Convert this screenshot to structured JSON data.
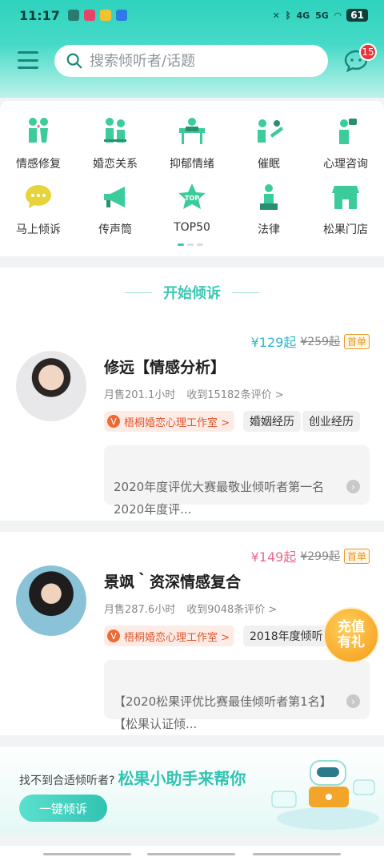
{
  "status": {
    "time": "11:17",
    "battery": "61",
    "net1": "4G",
    "net2": "5G"
  },
  "header": {
    "search_placeholder": "搜索倾听者/话题",
    "msg_badge": "15"
  },
  "categories": [
    {
      "label": "情感修复",
      "icon": "couple-icon"
    },
    {
      "label": "婚恋关系",
      "icon": "marriage-icon"
    },
    {
      "label": "抑郁情绪",
      "icon": "depression-icon"
    },
    {
      "label": "催眠",
      "icon": "hypnosis-icon"
    },
    {
      "label": "心理咨询",
      "icon": "counseling-icon"
    },
    {
      "label": "马上倾诉",
      "icon": "chat-bubble-icon"
    },
    {
      "label": "传声筒",
      "icon": "megaphone-icon"
    },
    {
      "label": "TOP50",
      "icon": "top-star-icon"
    },
    {
      "label": "法律",
      "icon": "law-icon"
    },
    {
      "label": "松果门店",
      "icon": "store-icon"
    }
  ],
  "section": {
    "title": "开始倾诉"
  },
  "listeners": [
    {
      "price_now": "¥129起",
      "price_old": "¥259起",
      "tag": "首单",
      "name": "修远【情感分析】",
      "sold": "月售201.1小时",
      "reviews": "收到15182条评价 >",
      "studio": "梧桐婚恋心理工作室 >",
      "chips": [
        "婚姻经历",
        "创业经历"
      ],
      "honor": "2020年度评优大赛最敬业倾听者第一名\n2020年度评...",
      "accent": "#2eb8c7"
    },
    {
      "price_now": "¥149起",
      "price_old": "¥299起",
      "tag": "首单",
      "name": "景飒｀资深情感复合",
      "sold": "月售287.6小时",
      "reviews": "收到9048条评价 >",
      "studio": "梧桐婚恋心理工作室 >",
      "chips": [
        "2018年度倾听者"
      ],
      "honor": "【2020松果评优比赛最佳倾听者第1名】\n【松果认证倾...",
      "accent": "#e96a8e"
    }
  ],
  "float_badge": "充值\n有礼",
  "helper": {
    "question": "找不到合适倾听者?",
    "highlight": "松果小助手来帮你",
    "button": "一键倾诉"
  }
}
